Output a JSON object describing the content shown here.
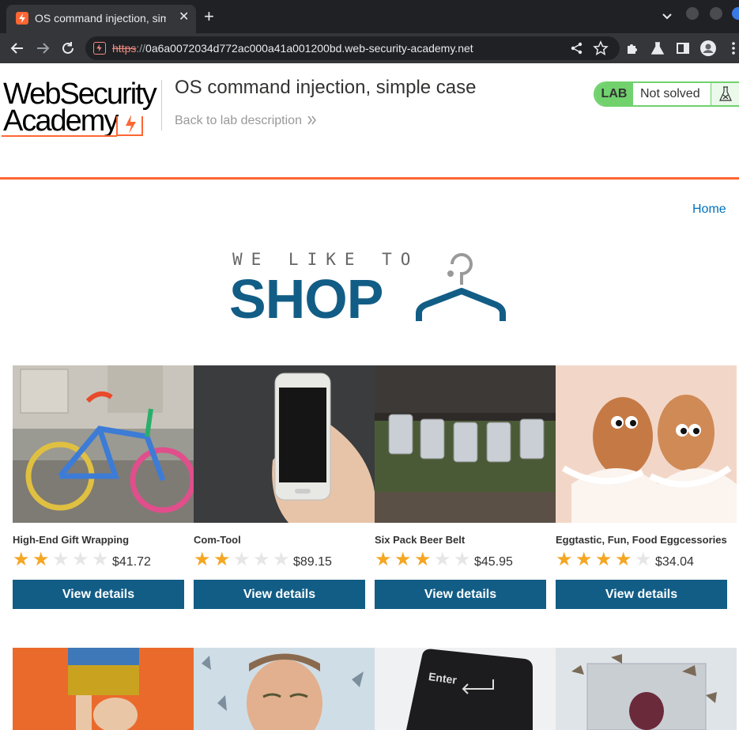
{
  "browser": {
    "tab_title": "OS command injection, simple case",
    "new_tab_label": "+",
    "url_scheme": "https",
    "url_sep": "://",
    "url_host": "0a6a0072034d772ac000a41a001200bd.web-security-academy.net"
  },
  "lab": {
    "logo_line1": "WebSecurity",
    "logo_line2": "Academy",
    "title": "OS command injection, simple case",
    "back_link": "Back to lab description",
    "badge": "LAB",
    "status": "Not solved",
    "status_color": "#70d16d"
  },
  "shop": {
    "home_link": "Home",
    "banner_small": "WE LIKE TO",
    "banner_big": "SHOP",
    "accent": "#125d86",
    "products": [
      {
        "name": "High-End Gift Wrapping",
        "price": "$41.72",
        "rating": 2,
        "button": "View details"
      },
      {
        "name": "Com-Tool",
        "price": "$89.15",
        "rating": 2,
        "button": "View details"
      },
      {
        "name": "Six Pack Beer Belt",
        "price": "$45.95",
        "rating": 3,
        "button": "View details"
      },
      {
        "name": "Eggtastic, Fun, Food Eggcessories",
        "price": "$34.04",
        "rating": 4,
        "button": "View details"
      }
    ],
    "row2_keycap_text": "Enter"
  }
}
